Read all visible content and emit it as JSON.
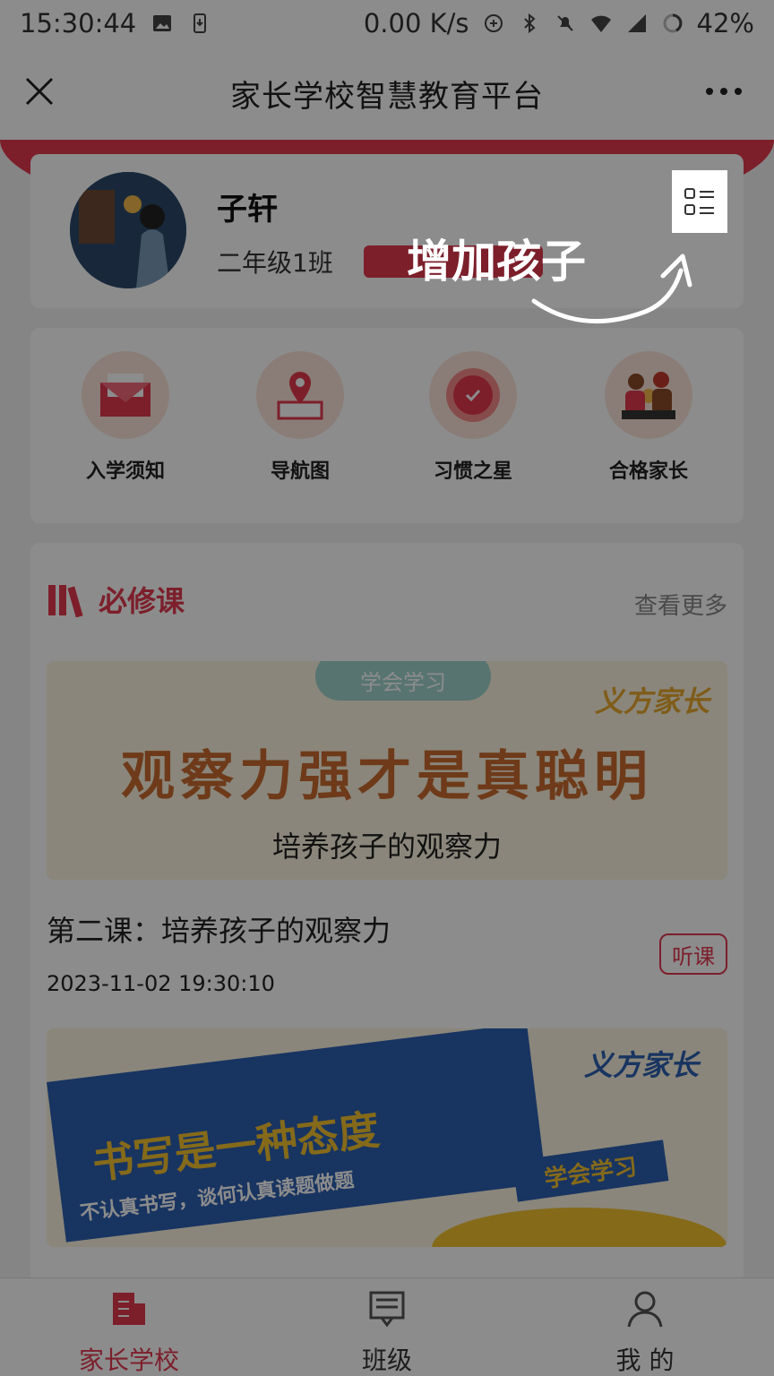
{
  "status_bar": {
    "time": "15:30:44",
    "speed": "0.00 K/s",
    "battery": "42%",
    "icons": [
      "image-icon",
      "download-icon",
      "data-saver-icon",
      "bluetooth-icon",
      "mute-icon",
      "wifi-icon",
      "signal-icon",
      "4g-icon",
      "battery-icon"
    ]
  },
  "titlebar": {
    "title": "家长学校智慧教育平台"
  },
  "profile": {
    "name": "子轩",
    "class_name": "二年级1班"
  },
  "guide": {
    "hint": "增加孩子"
  },
  "quick_menu": [
    {
      "label": "入学须知",
      "icon": "envelope-icon"
    },
    {
      "label": "导航图",
      "icon": "map-pin-icon"
    },
    {
      "label": "习惯之星",
      "icon": "clock-icon"
    },
    {
      "label": "合格家长",
      "icon": "family-icon"
    }
  ],
  "course_section": {
    "title": "必修课",
    "more": "查看更多",
    "banner1": {
      "tag": "学会学习",
      "brand": "义方家长",
      "headline": "观察力强才是真聪明",
      "subtitle": "培养孩子的观察力"
    },
    "lesson": {
      "title": "第二课：培养孩子的观察力",
      "time": "2023-11-02 19:30:10",
      "action": "听课"
    },
    "banner2": {
      "brand": "义方家长",
      "headline": "书写是一种态度",
      "subtitle": "不认真书写，谈何认真读题做题",
      "tag": "学会学习"
    }
  },
  "tabbar": {
    "items": [
      {
        "label": "家长学校",
        "icon": "school-icon",
        "active": true
      },
      {
        "label": "班级",
        "icon": "class-icon",
        "active": false
      },
      {
        "label": "我 的",
        "icon": "user-icon",
        "active": false
      }
    ]
  },
  "colors": {
    "accent": "#e23a4f",
    "brand_blue": "#2d5fb1",
    "brand_yellow": "#f2c230"
  }
}
